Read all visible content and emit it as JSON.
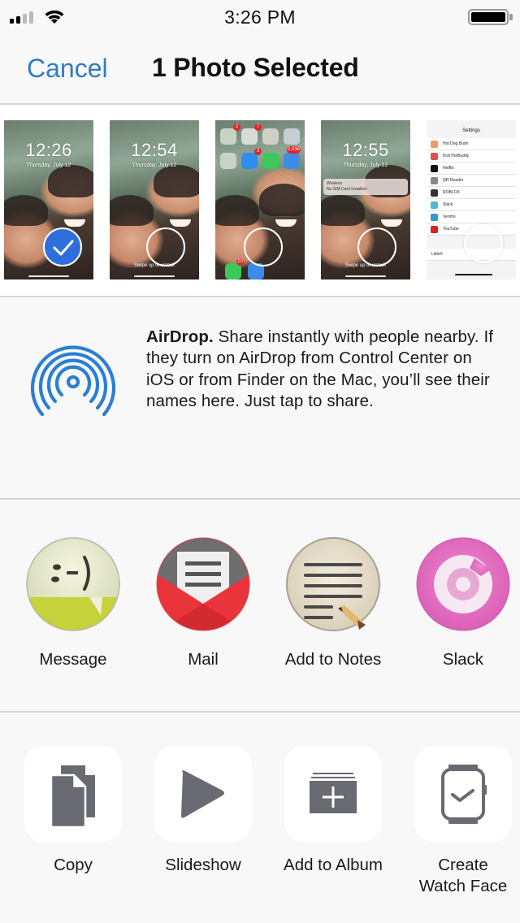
{
  "status_bar": {
    "time": "3:26 PM",
    "signal_bars_filled": 2,
    "signal_bars_total": 4,
    "battery_level": 1.0
  },
  "nav": {
    "cancel_label": "Cancel",
    "title": "1 Photo Selected"
  },
  "photos": [
    {
      "type": "lockscreen",
      "time": "12:26",
      "date": "Thursday, July 12",
      "selected": true
    },
    {
      "type": "lockscreen",
      "time": "12:54",
      "date": "Thursday, July 12",
      "selected": false,
      "footer": "Swipe up to unlock"
    },
    {
      "type": "homescreen",
      "selected": false,
      "badges": [
        "2",
        "7",
        "3",
        "2,038",
        "20"
      ]
    },
    {
      "type": "lockscreen",
      "time": "12:55",
      "date": "Thursday, July 12",
      "selected": false,
      "notification_title": "Wireless",
      "notification_body": "No SIM Card Installed",
      "footer": "Swipe up to unlock"
    },
    {
      "type": "settings",
      "selected": false,
      "title": "Settings",
      "rows": [
        "Hot Dog Bush",
        "KickTheBuddy",
        "Netflix",
        "QR Reader",
        "ROBLOX",
        "Slack",
        "Venmo",
        "YouTube"
      ],
      "extra_row": "LittleX"
    }
  ],
  "airdrop": {
    "title": "AirDrop.",
    "body": " Share instantly with people nearby. If they turn on AirDrop from Control Center on iOS or from Finder on the Mac, you’ll see their names here. Just tap to share.",
    "accent": "#2a7fd4"
  },
  "share_apps": [
    {
      "label": "Message",
      "icon": "message-icon"
    },
    {
      "label": "Mail",
      "icon": "mail-icon"
    },
    {
      "label": "Add to Notes",
      "icon": "notes-icon"
    },
    {
      "label": "Slack",
      "icon": "slack-icon"
    }
  ],
  "actions": [
    {
      "label": "Copy",
      "icon": "copy-icon"
    },
    {
      "label": "Slideshow",
      "icon": "play-icon"
    },
    {
      "label": "Add to Album",
      "icon": "add-album-icon"
    },
    {
      "label": "Create\nWatch Face",
      "line1": "Create",
      "line2": "Watch Face",
      "icon": "watch-icon"
    }
  ],
  "colors": {
    "link": "#2f7cc8",
    "selection": "#2f6fdc",
    "action_glyph": "#6a6a70"
  }
}
